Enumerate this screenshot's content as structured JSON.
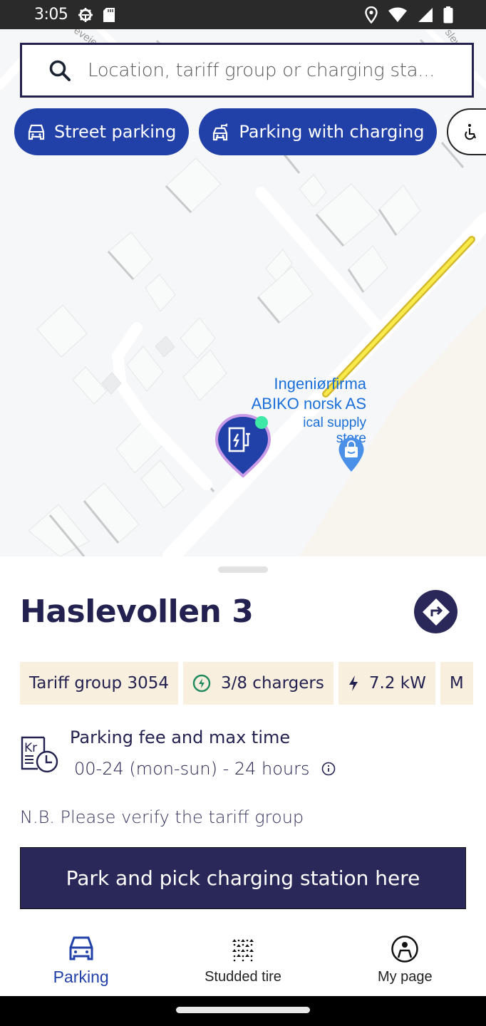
{
  "status_bar": {
    "time": "3:05",
    "left_icons": [
      "settings-gear-icon",
      "sd-card-icon"
    ],
    "right_icons": [
      "location-icon",
      "wifi-icon",
      "signal-icon",
      "battery-icon"
    ]
  },
  "search": {
    "placeholder": "Location, tariff group or charging sta...",
    "icon": "search-icon"
  },
  "filter_chips": [
    {
      "label": "Street parking",
      "icon": "car-icon",
      "active": true
    },
    {
      "label": "Parking with charging",
      "icon": "charging-car-icon",
      "active": true
    },
    {
      "label": "HC",
      "icon": "wheelchair-icon",
      "active": false
    }
  ],
  "map": {
    "poi_name_line1": "Ingeniørfirma",
    "poi_name_line2": "ABIKO norsk AS",
    "poi_category": "ical supply store",
    "street_label_left": "eveie",
    "street_label_right": "slev",
    "colors": {
      "route": "#f2dc3c",
      "pin_fill": "#2140a8",
      "pin_border": "#c99ae6",
      "pin_dot": "#3ee8a6",
      "poi": "#4a8fe8"
    }
  },
  "station": {
    "title": "Haslevollen 3",
    "directions_icon": "directions-icon",
    "tags": [
      {
        "label": "Tariff group 3054",
        "icon": null
      },
      {
        "label": "3/8 chargers",
        "icon": "charging-available-icon"
      },
      {
        "label": "7.2 kW",
        "icon": "bolt-icon"
      },
      {
        "label": "M",
        "icon": null
      }
    ],
    "fee": {
      "title": "Parking fee and max time",
      "value": "00-24 (mon-sun) - 24 hours",
      "icon_text": "Kr"
    },
    "note": "N.B. Please verify the tariff group",
    "primary_button": "Park and pick charging station here"
  },
  "bottom_nav": [
    {
      "label": "Parking",
      "icon": "car-icon",
      "active": true
    },
    {
      "label": "Studded tire",
      "icon": "studded-tire-icon",
      "active": false
    },
    {
      "label": "My page",
      "icon": "account-icon",
      "active": false
    }
  ],
  "colors": {
    "brand_dark": "#2a2859",
    "brand_blue": "#2140a8",
    "tag_bg": "#f8efdf",
    "charger_green": "#1f8a5e"
  }
}
